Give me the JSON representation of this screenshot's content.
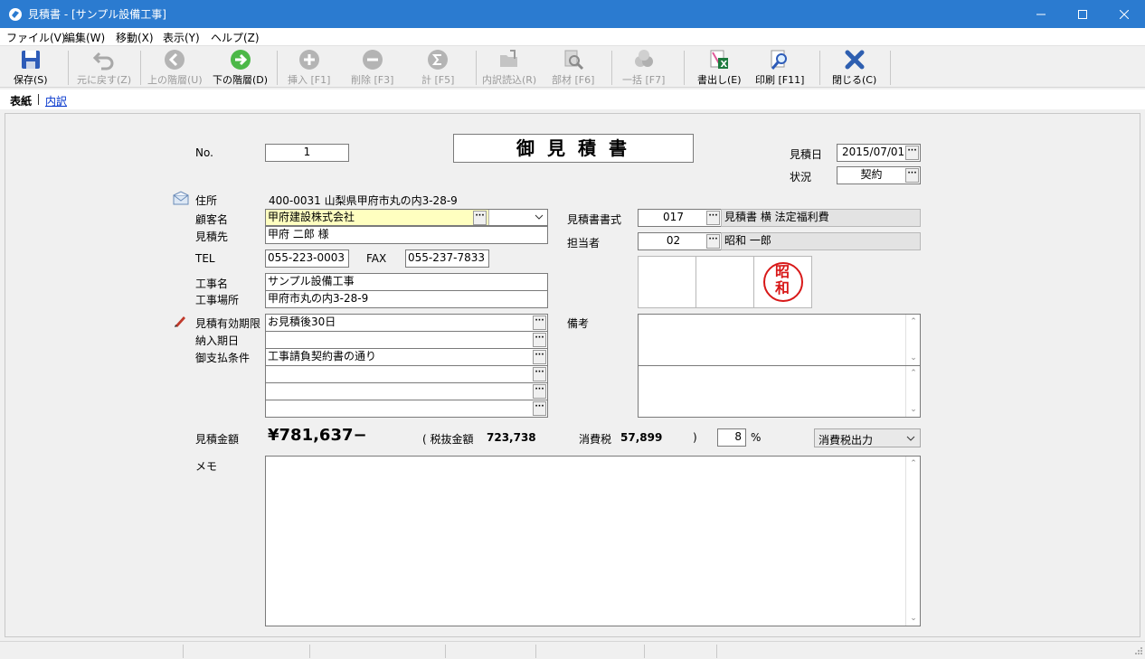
{
  "window": {
    "title": "見積書 - [サンプル設備工事]",
    "accent": "#2b7bd0"
  },
  "menu": {
    "items": [
      "ファイル(V)",
      "編集(W)",
      "移動(X)",
      "表示(Y)",
      "ヘルプ(Z)"
    ]
  },
  "toolbar": {
    "save": "保存(S)",
    "undo": "元に戻す(Z)",
    "up_level": "上の階層(U)",
    "down_level": "下の階層(D)",
    "insert": "挿入 [F1]",
    "delete": "削除 [F3]",
    "sum": "計 [F5]",
    "import": "内訳読込(R)",
    "material": "部材 [F6]",
    "batch": "一括 [F7]",
    "export": "書出し(E)",
    "print": "印刷 [F11]",
    "close": "閉じる(C)"
  },
  "tabs": {
    "cover": "表紙",
    "detail": "内訳"
  },
  "form": {
    "no_label": "No.",
    "no_value": "1",
    "doc_title": "御見積書",
    "date_label": "見積日",
    "date_value": "2015/07/01",
    "status_label": "状況",
    "status_value": "契約",
    "address_label": "住所",
    "address_value": "400-0031 山梨県甲府市丸の内3-28-9",
    "customer_label": "顧客名",
    "customer_value": "甲府建設株式会社",
    "dest_label": "見積先",
    "dest_value": "甲府 二郎 様",
    "tel_label": "TEL",
    "tel_value": "055-223-0003",
    "fax_label": "FAX",
    "fax_value": "055-237-7833",
    "project_label": "工事名",
    "project_value": "サンプル設備工事",
    "site_label": "工事場所",
    "site_value": "甲府市丸の内3-28-9",
    "validity_label": "見積有効期限",
    "validity_value": "お見積後30日",
    "delivery_label": "納入期日",
    "delivery_value": "",
    "payment_label": "御支払条件",
    "payment_value": "工事請負契約書の通り",
    "format_label": "見積書書式",
    "format_code": "017",
    "format_name": "見積書 横 法定福利費",
    "staff_label": "担当者",
    "staff_code": "02",
    "staff_name": "昭和 一郎",
    "stamp_line1": "昭",
    "stamp_line2": "和",
    "remarks_label": "備考",
    "amount_label": "見積金額",
    "amount_value": "¥781,637−",
    "pretax_label": "( 税抜金額",
    "pretax_value": "723,738",
    "tax_label": "消費税",
    "tax_value": "57,899",
    "paren_close": ")",
    "tax_rate": "8",
    "percent": "%",
    "tax_output": "消費税出力",
    "memo_label": "メモ",
    "dots": "···"
  }
}
